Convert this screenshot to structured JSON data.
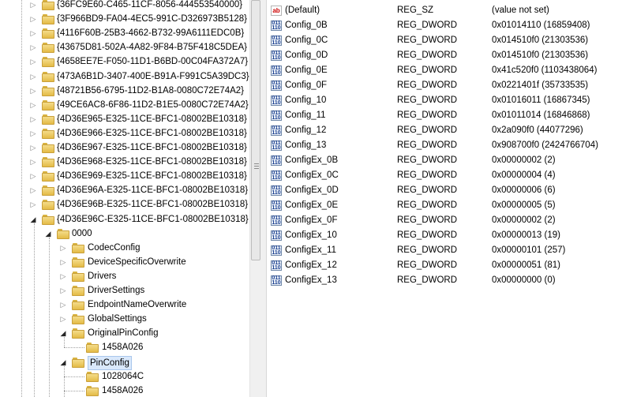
{
  "tree": {
    "guid_keys": [
      "{36FC9E60-C465-11CF-8056-444553540000}",
      "{3F966BD9-FA04-4EC5-991C-D326973B5128}",
      "{4116F60B-25B3-4662-B732-99A6111EDC0B}",
      "{43675D81-502A-4A82-9F84-B75F418C5DEA}",
      "{4658EE7E-F050-11D1-B6BD-00C04FA372A7}",
      "{473A6B1D-3407-400E-B91A-F991C5A39DC3}",
      "{48721B56-6795-11D2-B1A8-0080C72E74A2}",
      "{49CE6AC8-6F86-11D2-B1E5-0080C72E74A2}",
      "{4D36E965-E325-11CE-BFC1-08002BE10318}",
      "{4D36E966-E325-11CE-BFC1-08002BE10318}",
      "{4D36E967-E325-11CE-BFC1-08002BE10318}",
      "{4D36E968-E325-11CE-BFC1-08002BE10318}",
      "{4D36E969-E325-11CE-BFC1-08002BE10318}",
      "{4D36E96A-E325-11CE-BFC1-08002BE10318}",
      "{4D36E96B-E325-11CE-BFC1-08002BE10318}",
      "{4D36E96C-E325-11CE-BFC1-08002BE10318}"
    ],
    "subkey_0000": "0000",
    "children_0000": [
      "CodecConfig",
      "DeviceSpecificOverwrite",
      "Drivers",
      "DriverSettings",
      "EndpointNameOverwrite",
      "GlobalSettings",
      "OriginalPinConfig",
      "PinConfig"
    ],
    "original_pin_config_children": [
      "1458A026"
    ],
    "pin_config_children": [
      "1028064C",
      "1458A026"
    ],
    "selected": "PinConfig"
  },
  "values": [
    {
      "icon": "string-value-icon",
      "name": "(Default)",
      "type": "REG_SZ",
      "data": "(value not set)"
    },
    {
      "icon": "dword-value-icon",
      "name": "Config_0B",
      "type": "REG_DWORD",
      "data": "0x01014110 (16859408)"
    },
    {
      "icon": "dword-value-icon",
      "name": "Config_0C",
      "type": "REG_DWORD",
      "data": "0x014510f0 (21303536)"
    },
    {
      "icon": "dword-value-icon",
      "name": "Config_0D",
      "type": "REG_DWORD",
      "data": "0x014510f0 (21303536)"
    },
    {
      "icon": "dword-value-icon",
      "name": "Config_0E",
      "type": "REG_DWORD",
      "data": "0x41c520f0 (1103438064)"
    },
    {
      "icon": "dword-value-icon",
      "name": "Config_0F",
      "type": "REG_DWORD",
      "data": "0x0221401f (35733535)"
    },
    {
      "icon": "dword-value-icon",
      "name": "Config_10",
      "type": "REG_DWORD",
      "data": "0x01016011 (16867345)"
    },
    {
      "icon": "dword-value-icon",
      "name": "Config_11",
      "type": "REG_DWORD",
      "data": "0x01011014 (16846868)"
    },
    {
      "icon": "dword-value-icon",
      "name": "Config_12",
      "type": "REG_DWORD",
      "data": "0x2a090f0 (44077296)"
    },
    {
      "icon": "dword-value-icon",
      "name": "Config_13",
      "type": "REG_DWORD",
      "data": "0x908700f0 (2424766704)"
    },
    {
      "icon": "dword-value-icon",
      "name": "ConfigEx_0B",
      "type": "REG_DWORD",
      "data": "0x00000002 (2)"
    },
    {
      "icon": "dword-value-icon",
      "name": "ConfigEx_0C",
      "type": "REG_DWORD",
      "data": "0x00000004 (4)"
    },
    {
      "icon": "dword-value-icon",
      "name": "ConfigEx_0D",
      "type": "REG_DWORD",
      "data": "0x00000006 (6)"
    },
    {
      "icon": "dword-value-icon",
      "name": "ConfigEx_0E",
      "type": "REG_DWORD",
      "data": "0x00000005 (5)"
    },
    {
      "icon": "dword-value-icon",
      "name": "ConfigEx_0F",
      "type": "REG_DWORD",
      "data": "0x00000002 (2)"
    },
    {
      "icon": "dword-value-icon",
      "name": "ConfigEx_10",
      "type": "REG_DWORD",
      "data": "0x00000013 (19)"
    },
    {
      "icon": "dword-value-icon",
      "name": "ConfigEx_11",
      "type": "REG_DWORD",
      "data": "0x00000101 (257)"
    },
    {
      "icon": "dword-value-icon",
      "name": "ConfigEx_12",
      "type": "REG_DWORD",
      "data": "0x00000051 (81)"
    },
    {
      "icon": "dword-value-icon",
      "name": "ConfigEx_13",
      "type": "REG_DWORD",
      "data": "0x00000000 (0)"
    }
  ]
}
